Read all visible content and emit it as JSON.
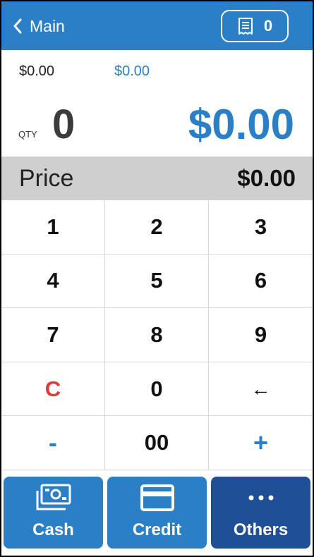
{
  "header": {
    "back_label": "Main",
    "receipt_count": "0"
  },
  "summary": {
    "subtotal_left": "$0.00",
    "subtotal_right": "$0.00",
    "qty_label": "QTY",
    "qty_value": "0",
    "total": "$0.00"
  },
  "price": {
    "label": "Price",
    "value": "$0.00"
  },
  "keypad": {
    "k1": "1",
    "k2": "2",
    "k3": "3",
    "k4": "4",
    "k5": "5",
    "k6": "6",
    "k7": "7",
    "k8": "8",
    "k9": "9",
    "clear": "C",
    "k0": "0",
    "backspace": "←",
    "minus": "-",
    "k00": "00",
    "plus": "+"
  },
  "actions": {
    "cash": "Cash",
    "credit": "Credit",
    "others": "Others"
  },
  "colors": {
    "primary": "#2a7fc6",
    "dark_primary": "#1f4f96",
    "clear_red": "#e03a3a",
    "price_bar": "#cfcfcf"
  },
  "icons": {
    "back": "chevron-left-icon",
    "receipt": "receipt-icon",
    "cash": "cash-icon",
    "credit": "credit-card-icon",
    "others": "more-dots-icon"
  }
}
